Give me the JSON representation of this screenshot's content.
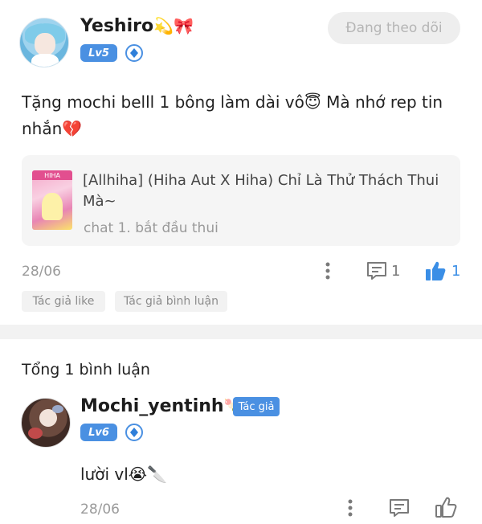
{
  "post": {
    "author": {
      "name": "Yeshiro",
      "name_emoji": "💫🎀",
      "level": "Lv5"
    },
    "follow_label": "Đang theo dõi",
    "text": "Tặng mochi belll 1 bông làm dài vô😇 Mà nhớ rep tin nhắn💔",
    "story": {
      "cover_text": "HIHA",
      "title": "[Allhiha] (Hiha Aut X Hiha) Chỉ Là Thử Thách Thui Mà~",
      "subtitle": "chat 1. bắt đầu thui"
    },
    "date": "28/06",
    "comment_count": "1",
    "like_count": "1",
    "tags": [
      "Tác giả like",
      "Tác giả bình luận"
    ]
  },
  "comments_header": "Tổng 1 bình luận",
  "comment": {
    "author": {
      "name": "Mochi_yentinh",
      "name_emoji": "🍡",
      "level": "Lv6",
      "badge": "Tác giả"
    },
    "text": "lười vl😭🔪",
    "date": "28/06"
  },
  "colors": {
    "accent": "#4a90e2",
    "muted": "#9a9a9a",
    "tag_bg": "#f2f2f2",
    "card_bg": "#f5f5f5"
  },
  "icons": [
    "more-vertical-icon",
    "comment-icon",
    "thumbs-up-filled-icon",
    "thumbs-up-outline-icon",
    "diamond-icon"
  ]
}
